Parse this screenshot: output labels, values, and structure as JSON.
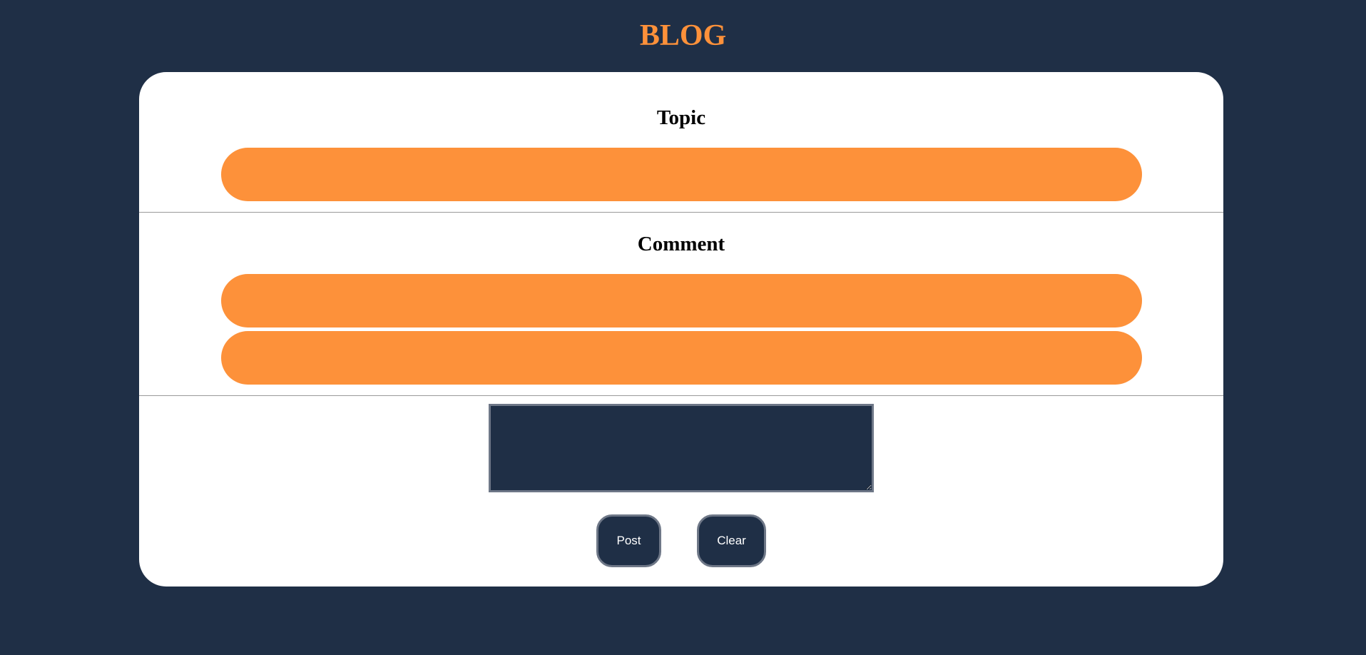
{
  "header": {
    "title": "BLOG"
  },
  "form": {
    "topic_heading": "Topic",
    "comment_heading": "Comment",
    "comment_box": {
      "value": "",
      "placeholder": ""
    },
    "post_label": "Post",
    "clear_label": "Clear"
  },
  "colors": {
    "background": "#1f2f46",
    "accent": "#fd913a",
    "card": "#ffffff",
    "button_border": "#6e7787"
  }
}
